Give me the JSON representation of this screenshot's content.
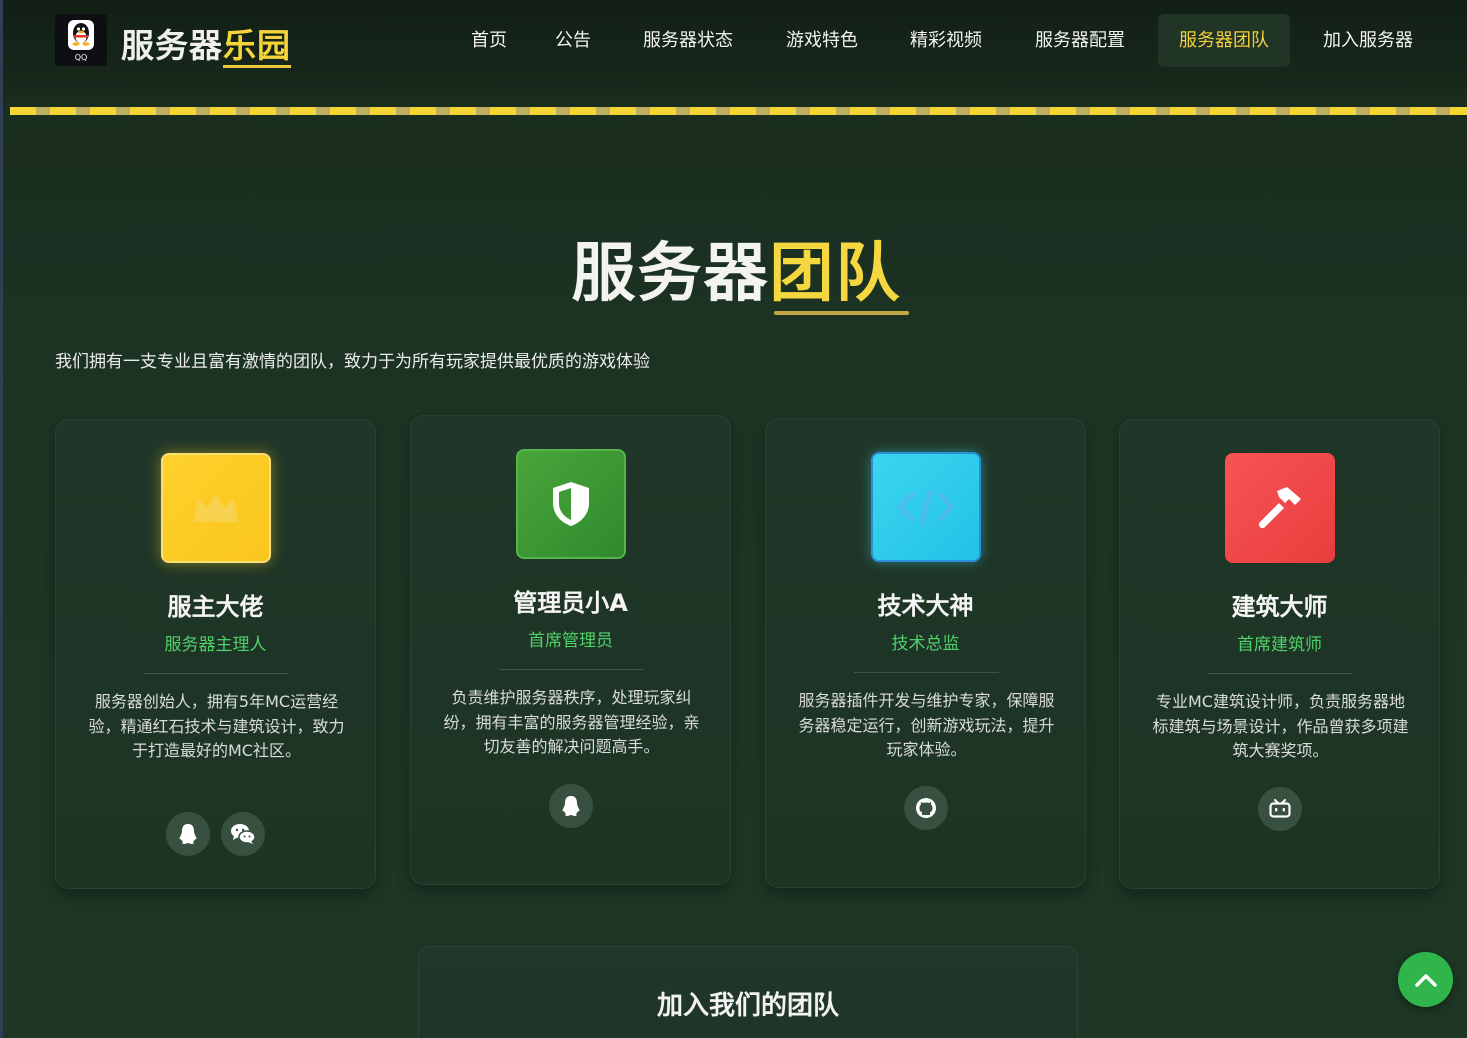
{
  "header": {
    "logo_caption": "QQ",
    "brand_part1": "服务器",
    "brand_part2": "乐园",
    "nav": [
      "首页",
      "公告",
      "服务器状态",
      "游戏特色",
      "精彩视频",
      "服务器配置",
      "服务器团队",
      "加入服务器"
    ],
    "active_nav": "服务器团队"
  },
  "section": {
    "title_part1": "服务器",
    "title_part2": "团队",
    "intro": "我们拥有一支专业且富有激情的团队，致力于为所有玩家提供最优质的游戏体验"
  },
  "members": [
    {
      "name": "服主大佬",
      "role": "服务器主理人",
      "desc": "服务器创始人，拥有5年MC运营经验，精通红石技术与建筑设计，致力于打造最好的MC社区。",
      "avatar_icon": "crown-icon",
      "avatar_color": "#ffd12c",
      "socials": [
        "qq-icon",
        "wechat-icon"
      ]
    },
    {
      "name": "管理员小A",
      "role": "首席管理员",
      "desc": "负责维护服务器秩序，处理玩家纠纷，拥有丰富的服务器管理经验，亲切友善的解决问题高手。",
      "avatar_icon": "shield-icon",
      "avatar_color": "#3d9a34",
      "socials": [
        "qq-icon"
      ]
    },
    {
      "name": "技术大神",
      "role": "技术总监",
      "desc": "服务器插件开发与维护专家，保障服务器稳定运行，创新游戏玩法，提升玩家体验。",
      "avatar_icon": "code-icon",
      "avatar_color": "#2fcdea",
      "socials": [
        "github-icon"
      ]
    },
    {
      "name": "建筑大师",
      "role": "首席建筑师",
      "desc": "专业MC建筑设计师，负责服务器地标建筑与场景设计，作品曾获多项建筑大赛奖项。",
      "avatar_icon": "hammer-icon",
      "avatar_color": "#f04848",
      "socials": [
        "bilibili-icon"
      ]
    }
  ],
  "join": {
    "title": "加入我们的团队"
  },
  "colors": {
    "accent_yellow": "#f5d73f",
    "role_green": "#4fd169",
    "to_top_green": "#2fb54a"
  }
}
